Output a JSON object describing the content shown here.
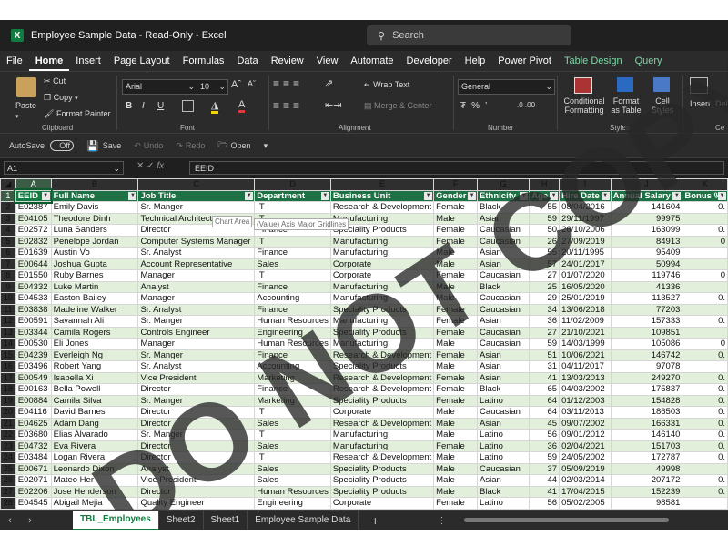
{
  "titlebar": {
    "app_icon": "excel-logo-icon",
    "title": "Employee Sample Data  -  Read-Only  -  Excel",
    "search_placeholder": "Search"
  },
  "menu": {
    "items": [
      "File",
      "Home",
      "Insert",
      "Page Layout",
      "Formulas",
      "Data",
      "Review",
      "View",
      "Automate",
      "Developer",
      "Help",
      "Power Pivot",
      "Table Design",
      "Query"
    ],
    "active": "Home"
  },
  "ribbon": {
    "paste": "Paste",
    "cut": "Cut",
    "copy": "Copy",
    "format_painter": "Format Painter",
    "clipboard_group": "Clipboard",
    "font_name": "Arial",
    "font_size": "10",
    "bold": "B",
    "italic": "I",
    "underline": "U",
    "font_group": "Font",
    "wrap_text": "Wrap Text",
    "merge_center": "Merge & Center",
    "alignment_group": "Alignment",
    "number_format": "General",
    "number_group": "Number",
    "conditional_formatting": "Conditional Formatting",
    "format_as_table": "Format as Table",
    "cell_styles": "Cell Styles",
    "styles_group": "Styles",
    "insert": "Insert",
    "delete": "Del",
    "cells_group": "Ce"
  },
  "quick_access": {
    "autosave": "AutoSave",
    "autosave_state": "Off",
    "save": "Save",
    "undo": "Undo",
    "redo": "Redo",
    "open": "Open"
  },
  "formula_bar": {
    "cell_ref": "A1",
    "fx": "fx",
    "value": "EEID"
  },
  "grid": {
    "columns": [
      "A",
      "B",
      "C",
      "D",
      "E",
      "F",
      "G",
      "H",
      "I",
      "J",
      "K"
    ],
    "selected_column": "A",
    "selected_row": "1",
    "headers": [
      "EEID",
      "Full Name",
      "Job Title",
      "Department",
      "Business Unit",
      "Gender",
      "Ethnicity",
      "Age",
      "Hire Date",
      "Annual Salary",
      "Bonus %"
    ],
    "rows": [
      [
        "E02387",
        "Emily Davis",
        "Sr. Manger",
        "IT",
        "Research & Development",
        "Female",
        "Black",
        "55",
        "08/04/2016",
        "141604",
        "0."
      ],
      [
        "E04105",
        "Theodore Dinh",
        "Technical Architect",
        "IT",
        "Manufacturing",
        "Male",
        "Asian",
        "59",
        "29/11/1997",
        "99975",
        ""
      ],
      [
        "E02572",
        "Luna Sanders",
        "Director",
        "Finance",
        "Speciality Products",
        "Female",
        "Caucasian",
        "50",
        "26/10/2006",
        "163099",
        "0."
      ],
      [
        "E02832",
        "Penelope Jordan",
        "Computer Systems Manager",
        "IT",
        "Manufacturing",
        "Female",
        "Caucasian",
        "26",
        "27/09/2019",
        "84913",
        "0"
      ],
      [
        "E01639",
        "Austin Vo",
        "Sr. Analyst",
        "Finance",
        "Manufacturing",
        "Male",
        "Asian",
        "55",
        "20/11/1995",
        "95409",
        ""
      ],
      [
        "E00644",
        "Joshua Gupta",
        "Account Representative",
        "Sales",
        "Corporate",
        "Male",
        "Asian",
        "57",
        "24/01/2017",
        "50994",
        ""
      ],
      [
        "E01550",
        "Ruby Barnes",
        "Manager",
        "IT",
        "Corporate",
        "Female",
        "Caucasian",
        "27",
        "01/07/2020",
        "119746",
        "0"
      ],
      [
        "E04332",
        "Luke Martin",
        "Analyst",
        "Finance",
        "Manufacturing",
        "Male",
        "Black",
        "25",
        "16/05/2020",
        "41336",
        ""
      ],
      [
        "E04533",
        "Easton Bailey",
        "Manager",
        "Accounting",
        "Manufacturing",
        "Male",
        "Caucasian",
        "29",
        "25/01/2019",
        "113527",
        "0."
      ],
      [
        "E03838",
        "Madeline Walker",
        "Sr. Analyst",
        "Finance",
        "Speciality Products",
        "Female",
        "Caucasian",
        "34",
        "13/06/2018",
        "77203",
        ""
      ],
      [
        "E00591",
        "Savannah Ali",
        "Sr. Manger",
        "Human Resources",
        "Manufacturing",
        "Female",
        "Asian",
        "36",
        "11/02/2009",
        "157333",
        "0."
      ],
      [
        "E03344",
        "Camila Rogers",
        "Controls Engineer",
        "Engineering",
        "Speciality Products",
        "Female",
        "Caucasian",
        "27",
        "21/10/2021",
        "109851",
        ""
      ],
      [
        "E00530",
        "Eli Jones",
        "Manager",
        "Human Resources",
        "Manufacturing",
        "Male",
        "Caucasian",
        "59",
        "14/03/1999",
        "105086",
        "0"
      ],
      [
        "E04239",
        "Everleigh Ng",
        "Sr. Manger",
        "Finance",
        "Research & Development",
        "Female",
        "Asian",
        "51",
        "10/06/2021",
        "146742",
        "0."
      ],
      [
        "E03496",
        "Robert Yang",
        "Sr. Analyst",
        "Accounting",
        "Speciality Products",
        "Male",
        "Asian",
        "31",
        "04/11/2017",
        "97078",
        ""
      ],
      [
        "E00549",
        "Isabella Xi",
        "Vice President",
        "Marketing",
        "Research & Development",
        "Female",
        "Asian",
        "41",
        "13/03/2013",
        "249270",
        "0."
      ],
      [
        "E00163",
        "Bella Powell",
        "Director",
        "Finance",
        "Research & Development",
        "Female",
        "Black",
        "65",
        "04/03/2002",
        "175837",
        "0."
      ],
      [
        "E00884",
        "Camila Silva",
        "Sr. Manger",
        "Marketing",
        "Speciality Products",
        "Female",
        "Latino",
        "64",
        "01/12/2003",
        "154828",
        "0."
      ],
      [
        "E04116",
        "David Barnes",
        "Director",
        "IT",
        "Corporate",
        "Male",
        "Caucasian",
        "64",
        "03/11/2013",
        "186503",
        "0."
      ],
      [
        "E04625",
        "Adam Dang",
        "Director",
        "Sales",
        "Research & Development",
        "Male",
        "Asian",
        "45",
        "09/07/2002",
        "166331",
        "0."
      ],
      [
        "E03680",
        "Elias Alvarado",
        "Sr. Manger",
        "IT",
        "Manufacturing",
        "Male",
        "Latino",
        "56",
        "09/01/2012",
        "146140",
        "0."
      ],
      [
        "E04732",
        "Eva Rivera",
        "Director",
        "Sales",
        "Manufacturing",
        "Female",
        "Latino",
        "36",
        "02/04/2021",
        "151703",
        "0."
      ],
      [
        "E03484",
        "Logan Rivera",
        "Director",
        "IT",
        "Research & Development",
        "Male",
        "Latino",
        "59",
        "24/05/2002",
        "172787",
        "0."
      ],
      [
        "E00671",
        "Leonardo Dixon",
        "Analyst",
        "Sales",
        "Speciality Products",
        "Male",
        "Caucasian",
        "37",
        "05/09/2019",
        "49998",
        ""
      ],
      [
        "E02071",
        "Mateo Her",
        "Vice President",
        "Sales",
        "Speciality Products",
        "Male",
        "Asian",
        "44",
        "02/03/2014",
        "207172",
        "0."
      ],
      [
        "E02206",
        "Jose Henderson",
        "Director",
        "Human Resources",
        "Speciality Products",
        "Male",
        "Black",
        "41",
        "17/04/2015",
        "152239",
        "0."
      ],
      [
        "E04545",
        "Abigail Mejia",
        "Quality Engineer",
        "Engineering",
        "Corporate",
        "Female",
        "Latino",
        "56",
        "05/02/2005",
        "98581",
        ""
      ]
    ]
  },
  "tooltips": {
    "chart_area": "Chart Area",
    "gridlines": "(Value) Axis Major Gridlines"
  },
  "watermark": "DO NOT COPY",
  "sheets": {
    "tabs": [
      "TBL_Employees",
      "Sheet2",
      "Sheet1",
      "Employee Sample Data"
    ],
    "active": "TBL_Employees",
    "add": "+"
  },
  "colors": {
    "header_green": "#1e7145",
    "band_green": "#e2efda",
    "accent": "#107c41"
  }
}
